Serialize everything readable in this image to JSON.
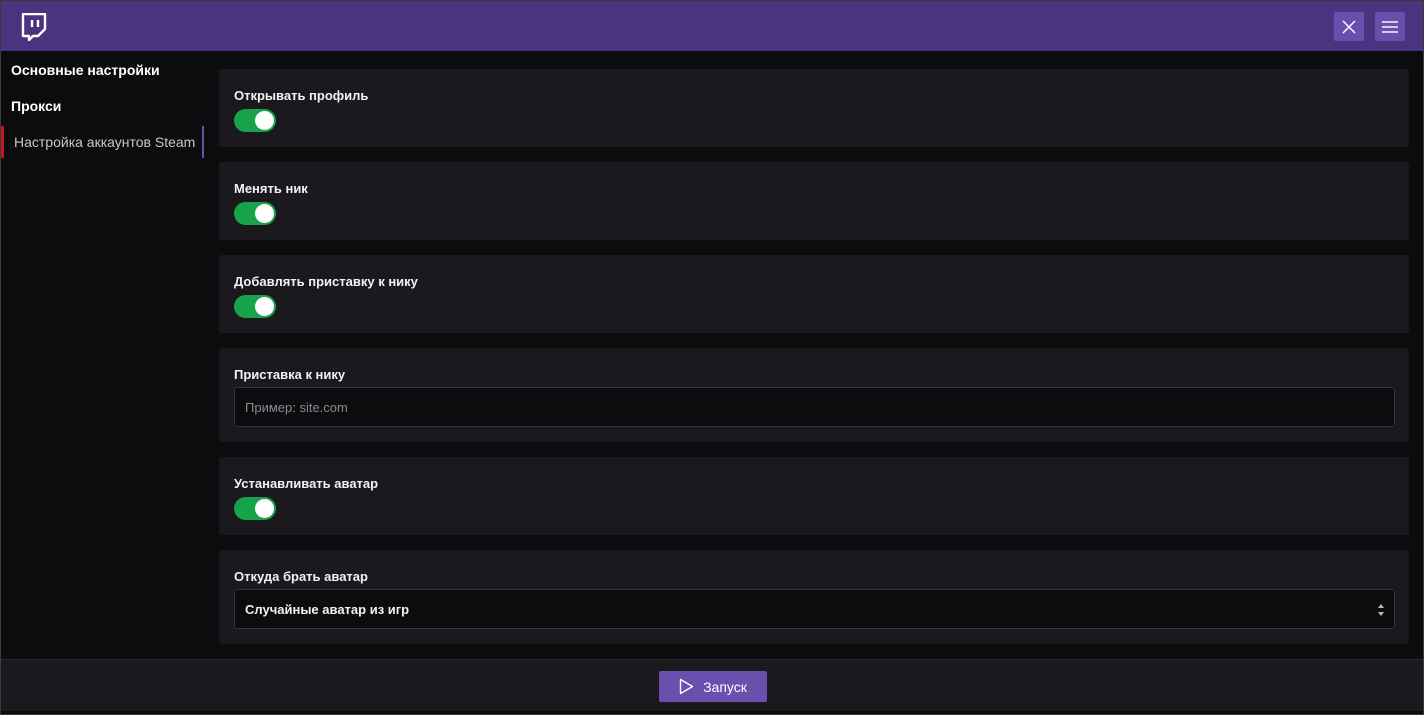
{
  "sidebar": {
    "items": [
      {
        "label": "Основные настройки"
      },
      {
        "label": "Прокси"
      },
      {
        "label": "Настройка аккаунтов Steam"
      }
    ]
  },
  "settings": {
    "open_profile": {
      "label": "Открывать профиль",
      "enabled": true
    },
    "change_nick": {
      "label": "Менять ник",
      "enabled": true
    },
    "add_prefix": {
      "label": "Добавлять приставку к нику",
      "enabled": true
    },
    "prefix": {
      "label": "Приставка к нику",
      "placeholder": "Пример: site.com",
      "value": ""
    },
    "set_avatar": {
      "label": "Устанавливать аватар",
      "enabled": true
    },
    "avatar_source": {
      "label": "Откуда брать аватар",
      "selected": "Случайные аватар из игр"
    }
  },
  "footer": {
    "run_label": "Запуск"
  },
  "colors": {
    "titlebar": "#4b337f",
    "accent": "#6a4fae",
    "toggle_on": "#16a34a",
    "active_marker": "#c4161c"
  },
  "icons": {
    "logo": "twitch-logo-icon",
    "close": "close-icon",
    "menu": "hamburger-menu-icon",
    "run": "play-icon"
  }
}
